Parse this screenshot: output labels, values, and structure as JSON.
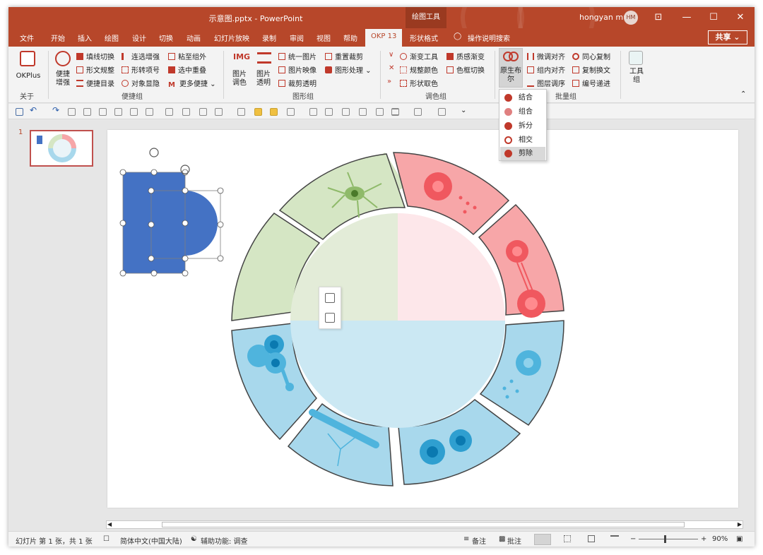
{
  "titlebar": {
    "title": "示意图.pptx  -  PowerPoint",
    "context_tab": "绘图工具",
    "user": "hongyan mu",
    "avatar_initials": "HM",
    "minimize": "—",
    "restore": "☐",
    "close": "✕",
    "ribbon_display": "⊡"
  },
  "tabs": [
    "文件",
    "开始",
    "插入",
    "绘图",
    "设计",
    "切换",
    "动画",
    "幻灯片放映",
    "录制",
    "审阅",
    "视图",
    "帮助",
    "OKP 13",
    "形状格式"
  ],
  "active_tab": "OKP 13",
  "tell_me": "操作说明搜索",
  "share": "共享",
  "ribbon": {
    "okplus": "OKPlus",
    "okplus_group": "关于",
    "quick_enhance": "便捷\n增强",
    "col1": [
      "填线切换",
      "形文规整",
      "便捷目录"
    ],
    "col2": [
      "连选增强",
      "形转项号",
      "对象显隐"
    ],
    "col3": [
      "粘至组外",
      "选中重叠",
      "更多便捷"
    ],
    "group_quick": "便捷组",
    "img_color": "图片\n调色",
    "img_trans": "图片\n透明",
    "col4": [
      "统一图片",
      "图片映像",
      "裁剪透明"
    ],
    "col5": [
      "重置裁剪",
      "图形处理"
    ],
    "group_shape": "图形组",
    "col6": [
      "渐变工具",
      "规整颜色",
      "形状取色"
    ],
    "col7": [
      "质感渐变",
      "色框切换"
    ],
    "group_color": "调色组",
    "boolean": "原生布\n尔",
    "col8": [
      "微调对齐",
      "组内对齐",
      "图层调序"
    ],
    "col9": [
      "同心复制",
      "复制换文",
      "编号递进"
    ],
    "group_batch": "批量组",
    "tools": "工具\n组"
  },
  "boolean_menu": [
    "结合",
    "组合",
    "拆分",
    "相交",
    "剪除"
  ],
  "boolean_highlight": "剪除",
  "slide_number": "1",
  "status": {
    "slide_info": "幻灯片 第 1 张，共 1 张",
    "language": "简体中文(中国大陆)",
    "accessibility": "辅助功能: 调查",
    "notes": "备注",
    "comments": "批注",
    "zoom": "90%"
  },
  "colors": {
    "accent": "#b7472a",
    "green": "#d5e6c4",
    "red": "#f7a6a8",
    "blue": "#a8d8ec",
    "shape_blue": "#4472c4"
  }
}
